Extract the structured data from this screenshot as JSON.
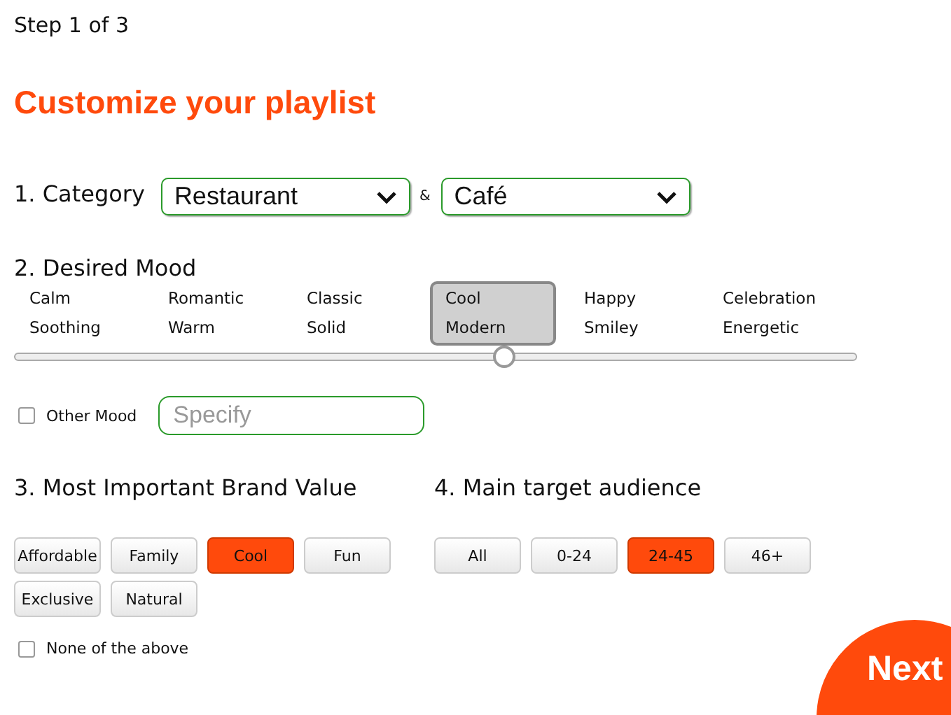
{
  "step": "Step 1 of 3",
  "title": "Customize your playlist",
  "category": {
    "label": "1. Category",
    "first": "Restaurant",
    "joiner": "&",
    "second": "Café"
  },
  "mood": {
    "label": "2. Desired Mood",
    "level": 0.58,
    "options": [
      {
        "top": "Calm",
        "bottom": "Soothing",
        "selected": false
      },
      {
        "top": "Romantic",
        "bottom": "Warm",
        "selected": false
      },
      {
        "top": "Classic",
        "bottom": "Solid",
        "selected": false
      },
      {
        "top": "Cool",
        "bottom": "Modern",
        "selected": true
      },
      {
        "top": "Happy",
        "bottom": "Smiley",
        "selected": false
      },
      {
        "top": "Celebration",
        "bottom": "Energetic",
        "selected": false
      }
    ],
    "other": {
      "label": "Other Mood",
      "checked": false,
      "placeholder": "Specify"
    }
  },
  "brand": {
    "label": "3. Most Important Brand Value",
    "options": [
      {
        "label": "Affordable",
        "selected": false
      },
      {
        "label": "Family",
        "selected": false
      },
      {
        "label": "Cool",
        "selected": true
      },
      {
        "label": "Fun",
        "selected": false
      },
      {
        "label": "Exclusive",
        "selected": false
      },
      {
        "label": "Natural",
        "selected": false
      }
    ],
    "none": {
      "label": "None of the above",
      "checked": false
    }
  },
  "audience": {
    "label": "4. Main target audience",
    "options": [
      {
        "label": "All",
        "selected": false
      },
      {
        "label": "0-24",
        "selected": false
      },
      {
        "label": "24-45",
        "selected": true
      },
      {
        "label": "46+",
        "selected": false
      }
    ]
  },
  "next": "Next"
}
